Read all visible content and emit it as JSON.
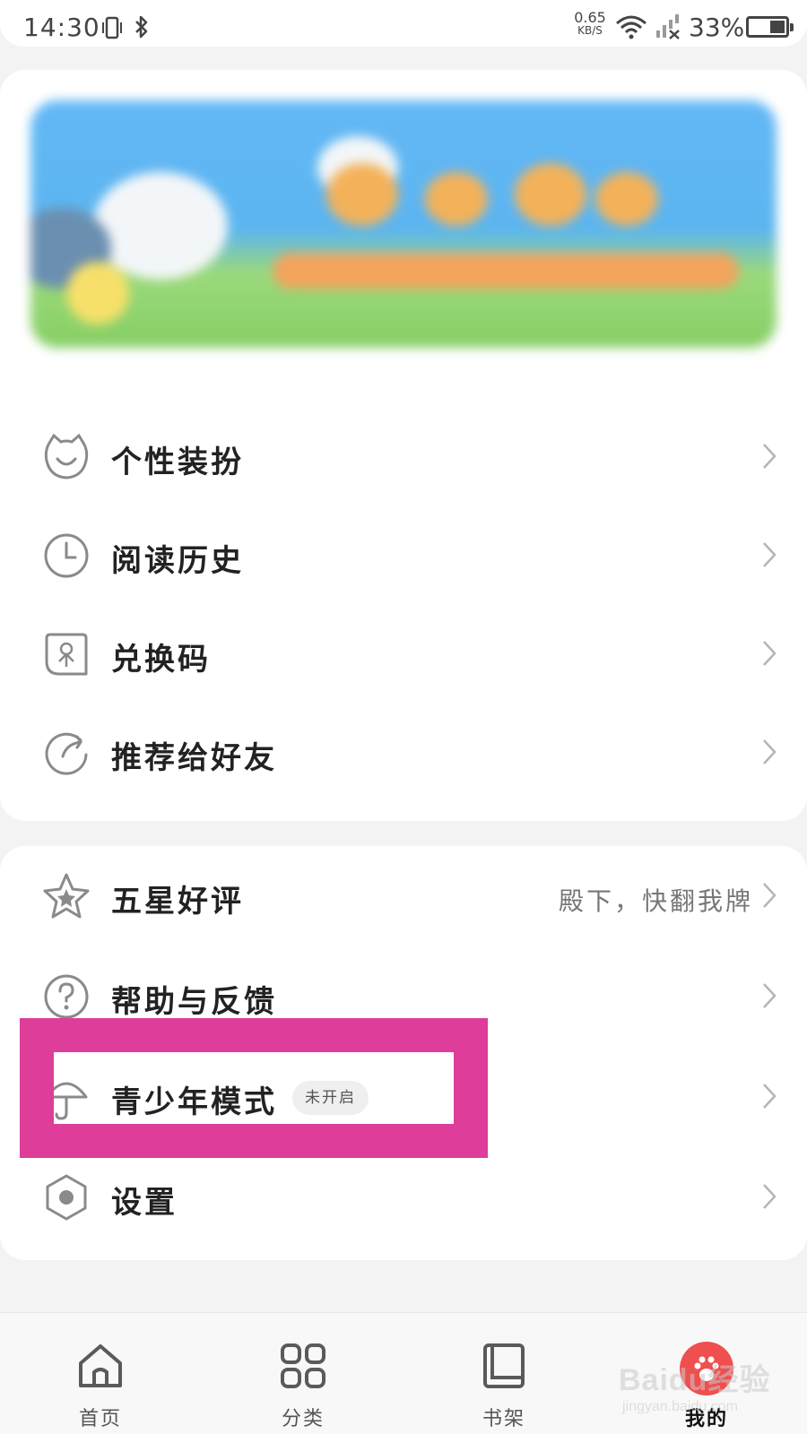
{
  "status_bar": {
    "time": "14:30",
    "net_speed_value": "0.65",
    "net_speed_unit": "KB/S",
    "battery_percent": "33%"
  },
  "menu_group_1": [
    {
      "label": "个性装扮",
      "icon": "cat-face-icon"
    },
    {
      "label": "阅读历史",
      "icon": "clock-icon"
    },
    {
      "label": "兑换码",
      "icon": "coupon-icon"
    },
    {
      "label": "推荐给好友",
      "icon": "share-arrow-icon"
    }
  ],
  "menu_group_2": [
    {
      "label": "五星好评",
      "icon": "star-icon",
      "extra": "殿下，快翻我牌"
    },
    {
      "label": "帮助与反馈",
      "icon": "help-circle-icon"
    },
    {
      "label": "青少年模式",
      "icon": "umbrella-icon",
      "badge": "未开启"
    },
    {
      "label": "设置",
      "icon": "hexagon-settings-icon"
    }
  ],
  "bottom_nav": [
    {
      "label": "首页",
      "icon": "home-icon"
    },
    {
      "label": "分类",
      "icon": "grid-icon"
    },
    {
      "label": "书架",
      "icon": "book-icon"
    },
    {
      "label": "我的",
      "icon": "paw-icon",
      "active": true
    }
  ],
  "watermark": {
    "main": "Baidu经验",
    "sub": "jingyan.baidu.com"
  },
  "colors": {
    "highlight": "#de3e9a",
    "active_tab": "#ef4f4f"
  }
}
